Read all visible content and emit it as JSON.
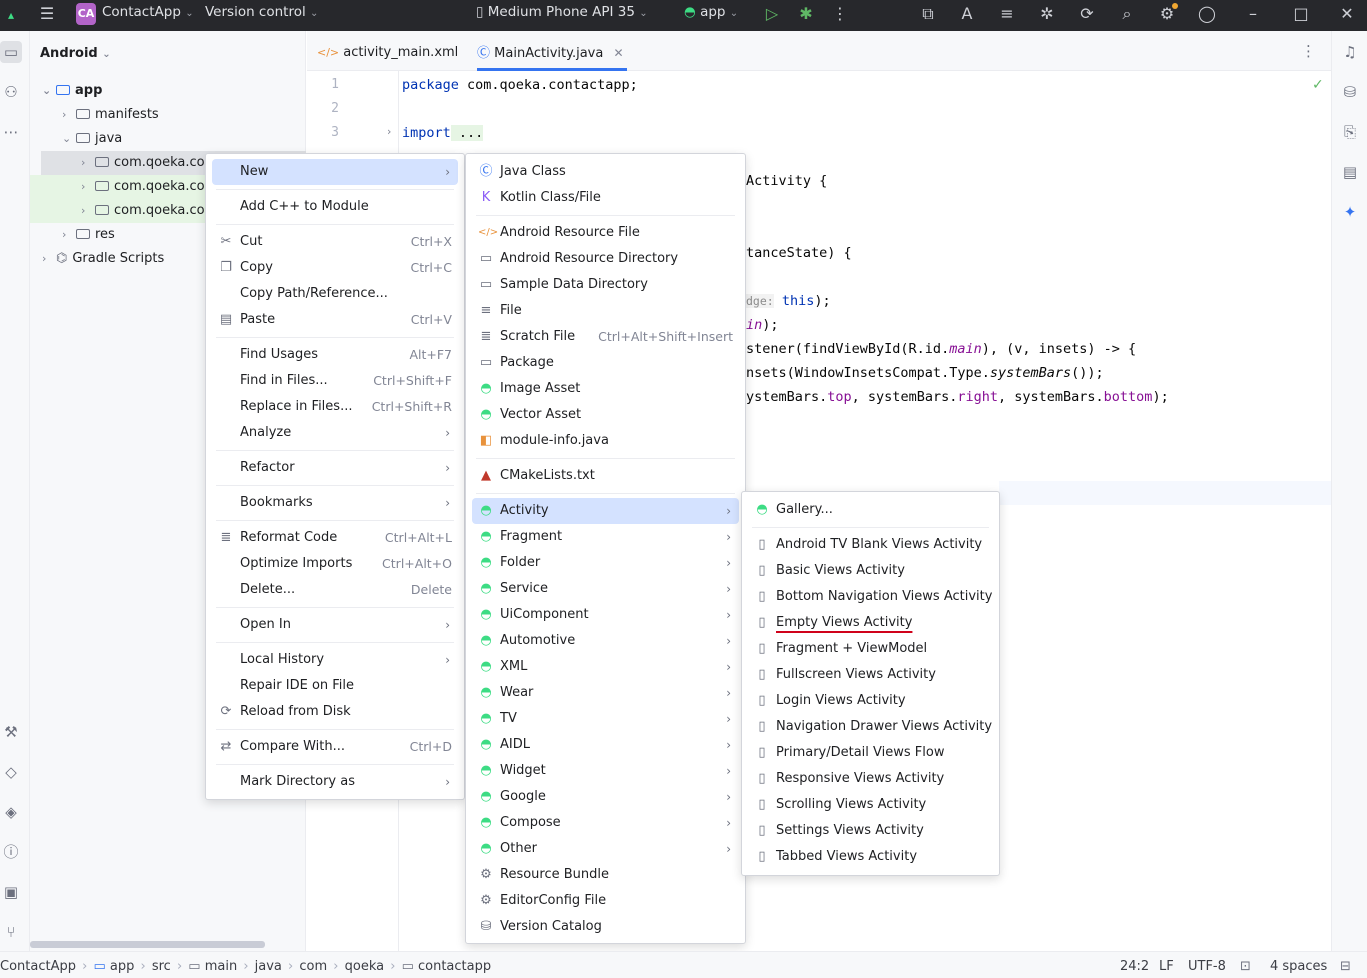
{
  "titlebar": {
    "project_badge": "CA",
    "project_name": "ContactApp",
    "vcs": "Version control",
    "device": "Medium Phone API 35",
    "run_config": "app"
  },
  "project_panel": {
    "view_mode": "Android",
    "tree": [
      "app",
      "manifests",
      "java",
      "com.qoeka.cor",
      "com.qoeka.cor",
      "com.qoeka.cor",
      "res",
      "Gradle Scripts"
    ]
  },
  "tabs": [
    {
      "label": "activity_main.xml"
    },
    {
      "label": "MainActivity.java"
    }
  ],
  "editor": {
    "line_numbers": [
      "1",
      "2",
      "3"
    ],
    "line1_kw": "package",
    "line1_rest": " com.qoeka.contactapp;",
    "line3_kw": "import",
    "line3_rest": " ...",
    "frag_activity": "Activity {",
    "frag_tance": "tanceState) {",
    "frag_dge_hint": "dge:",
    "frag_dge_this": "this",
    "frag_dge_end": ");",
    "frag_in": "in",
    "frag_in_end": ");",
    "frag_listener_a": "stener(findViewById(R.id.",
    "frag_listener_main": "main",
    "frag_listener_b": "), (v, insets) -> {",
    "frag_insets_a": "nsets(WindowInsetsCompat.Type.",
    "frag_insets_sys": "systemBars",
    "frag_insets_b": "());",
    "frag_bars_a": "ystemBars.",
    "frag_bars_top": "top",
    "frag_bars_b": ", systemBars.",
    "frag_bars_right": "right",
    "frag_bars_c": ", systemBars.",
    "frag_bars_bottom": "bottom",
    "frag_bars_d": ");"
  },
  "context_menu": [
    {
      "label": "New",
      "arrow": true,
      "selected": true
    },
    {
      "sep": true
    },
    {
      "label": "Add C++ to Module"
    },
    {
      "sep": true
    },
    {
      "label": "Cut",
      "shortcut": "Ctrl+X",
      "icon": "scissors-icon"
    },
    {
      "label": "Copy",
      "shortcut": "Ctrl+C",
      "icon": "copy-icon"
    },
    {
      "label": "Copy Path/Reference..."
    },
    {
      "label": "Paste",
      "shortcut": "Ctrl+V",
      "icon": "paste-icon"
    },
    {
      "sep": true
    },
    {
      "label": "Find Usages",
      "shortcut": "Alt+F7"
    },
    {
      "label": "Find in Files...",
      "shortcut": "Ctrl+Shift+F"
    },
    {
      "label": "Replace in Files...",
      "shortcut": "Ctrl+Shift+R"
    },
    {
      "label": "Analyze",
      "arrow": true
    },
    {
      "sep": true
    },
    {
      "label": "Refactor",
      "arrow": true
    },
    {
      "sep": true
    },
    {
      "label": "Bookmarks",
      "arrow": true
    },
    {
      "sep": true
    },
    {
      "label": "Reformat Code",
      "shortcut": "Ctrl+Alt+L",
      "icon": "reformat-icon"
    },
    {
      "label": "Optimize Imports",
      "shortcut": "Ctrl+Alt+O"
    },
    {
      "label": "Delete...",
      "shortcut": "Delete"
    },
    {
      "sep": true
    },
    {
      "label": "Open In",
      "arrow": true
    },
    {
      "sep": true
    },
    {
      "label": "Local History",
      "arrow": true
    },
    {
      "label": "Repair IDE on File"
    },
    {
      "label": "Reload from Disk",
      "icon": "reload-icon"
    },
    {
      "sep": true
    },
    {
      "label": "Compare With...",
      "shortcut": "Ctrl+D",
      "icon": "compare-icon"
    },
    {
      "sep": true
    },
    {
      "label": "Mark Directory as",
      "arrow": true
    }
  ],
  "new_menu": [
    {
      "label": "Java Class",
      "icon": "java-class-icon"
    },
    {
      "label": "Kotlin Class/File",
      "icon": "kotlin-icon"
    },
    {
      "sep": true
    },
    {
      "label": "Android Resource File",
      "icon": "xml-file-icon"
    },
    {
      "label": "Android Resource Directory",
      "icon": "folder-icon"
    },
    {
      "label": "Sample Data Directory",
      "icon": "folder-icon"
    },
    {
      "label": "File",
      "icon": "file-icon"
    },
    {
      "label": "Scratch File",
      "shortcut": "Ctrl+Alt+Shift+Insert",
      "icon": "scratch-file-icon"
    },
    {
      "label": "Package",
      "icon": "package-icon"
    },
    {
      "label": "Image Asset",
      "icon": "android-icon"
    },
    {
      "label": "Vector Asset",
      "icon": "android-icon"
    },
    {
      "label": "module-info.java",
      "icon": "module-icon"
    },
    {
      "sep": true
    },
    {
      "label": "CMakeLists.txt",
      "icon": "cmake-icon"
    },
    {
      "sep": true
    },
    {
      "label": "Activity",
      "arrow": true,
      "selected": true,
      "icon": "android-icon"
    },
    {
      "label": "Fragment",
      "arrow": true,
      "icon": "android-icon"
    },
    {
      "label": "Folder",
      "arrow": true,
      "icon": "android-icon"
    },
    {
      "label": "Service",
      "arrow": true,
      "icon": "android-icon"
    },
    {
      "label": "UiComponent",
      "arrow": true,
      "icon": "android-icon"
    },
    {
      "label": "Automotive",
      "arrow": true,
      "icon": "android-icon"
    },
    {
      "label": "XML",
      "arrow": true,
      "icon": "android-icon"
    },
    {
      "label": "Wear",
      "arrow": true,
      "icon": "android-icon"
    },
    {
      "label": "TV",
      "arrow": true,
      "icon": "android-icon"
    },
    {
      "label": "AIDL",
      "arrow": true,
      "icon": "android-icon"
    },
    {
      "label": "Widget",
      "arrow": true,
      "icon": "android-icon"
    },
    {
      "label": "Google",
      "arrow": true,
      "icon": "android-icon"
    },
    {
      "label": "Compose",
      "arrow": true,
      "icon": "android-icon"
    },
    {
      "label": "Other",
      "arrow": true,
      "icon": "android-icon"
    },
    {
      "label": "Resource Bundle",
      "icon": "gear-icon"
    },
    {
      "label": "EditorConfig File",
      "icon": "gear-icon"
    },
    {
      "label": "Version Catalog",
      "icon": "catalog-icon"
    }
  ],
  "activity_menu": [
    {
      "label": "Gallery...",
      "icon": "android-icon"
    },
    {
      "sep": true
    },
    {
      "label": "Android TV Blank Views Activity"
    },
    {
      "label": "Basic Views Activity"
    },
    {
      "label": "Bottom Navigation Views Activity"
    },
    {
      "label": "Empty Views Activity",
      "underlined": true
    },
    {
      "label": "Fragment + ViewModel"
    },
    {
      "label": "Fullscreen Views Activity"
    },
    {
      "label": "Login Views Activity"
    },
    {
      "label": "Navigation Drawer Views Activity"
    },
    {
      "label": "Primary/Detail Views Flow"
    },
    {
      "label": "Responsive Views Activity"
    },
    {
      "label": "Scrolling Views Activity"
    },
    {
      "label": "Settings Views Activity"
    },
    {
      "label": "Tabbed Views Activity"
    }
  ],
  "statusbar": {
    "breadcrumb": [
      "ContactApp",
      "app",
      "src",
      "main",
      "java",
      "com",
      "qoeka",
      "contactapp"
    ],
    "position": "24:2",
    "line_sep": "LF",
    "encoding": "UTF-8",
    "indent": "4 spaces"
  },
  "colors": {
    "accent_selection": "#d4e2ff",
    "android_green": "#3ddc84",
    "titlebar_bg": "#27282c",
    "annotation_red": "#d0021b"
  }
}
